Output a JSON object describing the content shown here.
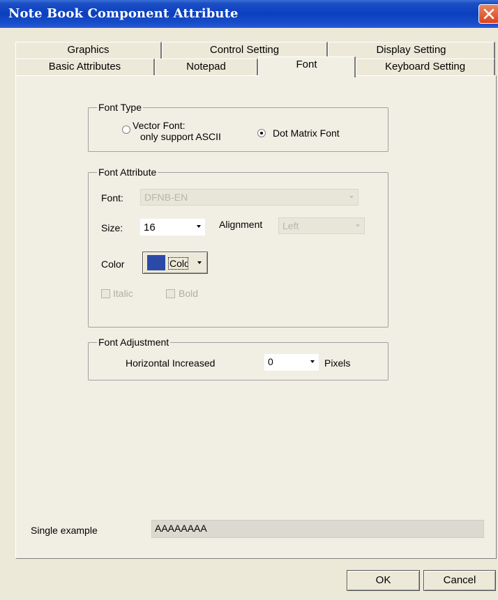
{
  "window": {
    "title": "Note Book Component Attribute"
  },
  "tabs": {
    "row1": [
      {
        "label": "Graphics"
      },
      {
        "label": "Control Setting"
      },
      {
        "label": "Display Setting"
      }
    ],
    "row2": [
      {
        "label": "Basic Attributes"
      },
      {
        "label": "Notepad"
      },
      {
        "label": "Font",
        "active": true
      },
      {
        "label": "Keyboard Setting"
      }
    ]
  },
  "font_type": {
    "legend": "Font Type",
    "vector_line1": "Vector Font:",
    "vector_line2": "only support ASCII",
    "dot_matrix": "Dot Matrix Font",
    "selected": "Dot Matrix Font"
  },
  "font_attribute": {
    "legend": "Font Attribute",
    "font_label": "Font:",
    "font_value": "DFNB-EN",
    "size_label": "Size:",
    "size_value": "16",
    "alignment_label": "Alignment",
    "alignment_value": "Left",
    "color_label": "Color",
    "color_button": "Color",
    "swatch_color": "#2b4aa8",
    "italic_label": "Italic",
    "bold_label": "Bold"
  },
  "font_adjustment": {
    "legend": "Font Adjustment",
    "horizontal_label": "Horizontal Increased",
    "horizontal_value": "0",
    "unit": "Pixels"
  },
  "sample": {
    "label": "Single example",
    "text": "AAAAAAAA"
  },
  "buttons": {
    "ok": "OK",
    "cancel": "Cancel"
  }
}
